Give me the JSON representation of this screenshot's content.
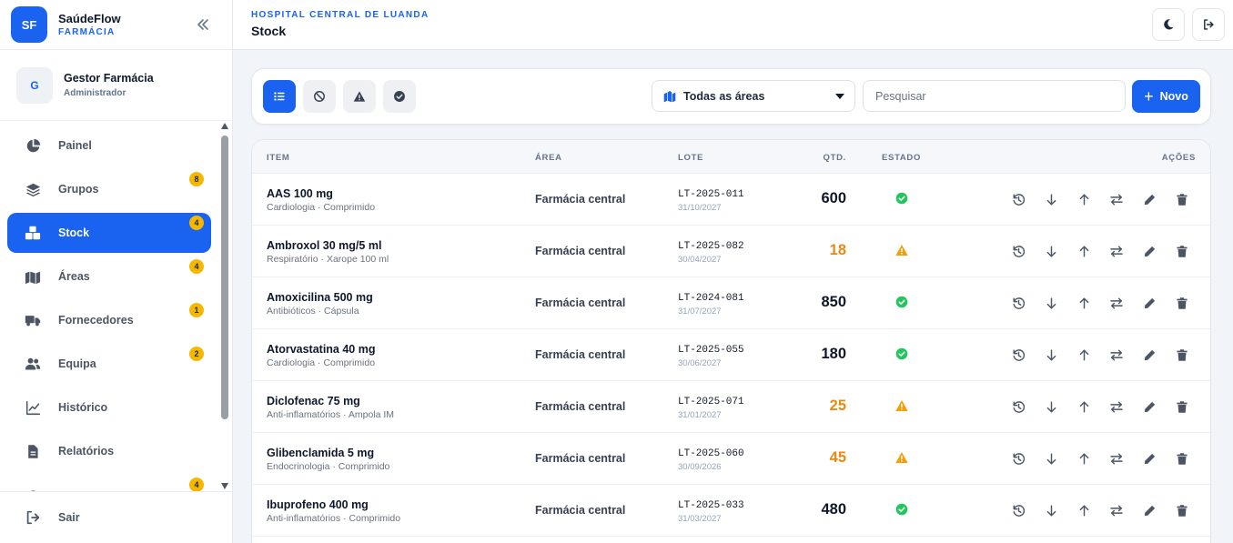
{
  "brand": {
    "logo": "SF",
    "name": "SaúdeFlow",
    "subtitle": "FARMÁCIA"
  },
  "user": {
    "initial": "G",
    "name": "Gestor Farmácia",
    "role": "Administrador"
  },
  "sidebar": {
    "items": [
      {
        "label": "Painel",
        "icon": "pie-chart-icon",
        "badge": ""
      },
      {
        "label": "Grupos",
        "icon": "layers-icon",
        "badge": "8"
      },
      {
        "label": "Stock",
        "icon": "boxes-icon",
        "badge": "4",
        "active": true
      },
      {
        "label": "Áreas",
        "icon": "map-icon",
        "badge": "4"
      },
      {
        "label": "Fornecedores",
        "icon": "truck-icon",
        "badge": "1"
      },
      {
        "label": "Equipa",
        "icon": "users-icon",
        "badge": "2"
      },
      {
        "label": "Histórico",
        "icon": "chart-line-icon",
        "badge": ""
      },
      {
        "label": "Relatórios",
        "icon": "file-icon",
        "badge": ""
      },
      {
        "label": "",
        "icon": "settings-icon",
        "badge": "4"
      }
    ],
    "logout_label": "Sair"
  },
  "header": {
    "hospital": "HOSPITAL CENTRAL DE LUANDA",
    "title": "Stock"
  },
  "toolbar": {
    "filters": [
      "list-icon",
      "ban-icon",
      "warning-icon",
      "check-circle-icon"
    ],
    "area_select": "Todas as áreas",
    "search_placeholder": "Pesquisar",
    "new_label": "Novo"
  },
  "table": {
    "columns": {
      "item": "ITEM",
      "area": "ÁREA",
      "lote": "LOTE",
      "qtd": "QTD.",
      "estado": "ESTADO",
      "acoes": "AÇÕES"
    },
    "rows": [
      {
        "name": "AAS 100 mg",
        "sub": "Cardiologia · Comprimido",
        "area": "Farmácia central",
        "lote": "LT-2025-011",
        "date": "31/10/2027",
        "qty": "600",
        "status": "ok"
      },
      {
        "name": "Ambroxol 30 mg/5 ml",
        "sub": "Respiratório · Xarope 100 ml",
        "area": "Farmácia central",
        "lote": "LT-2025-082",
        "date": "30/04/2027",
        "qty": "18",
        "status": "low"
      },
      {
        "name": "Amoxicilina 500 mg",
        "sub": "Antibióticos · Cápsula",
        "area": "Farmácia central",
        "lote": "LT-2024-081",
        "date": "31/07/2027",
        "qty": "850",
        "status": "ok"
      },
      {
        "name": "Atorvastatina 40 mg",
        "sub": "Cardiologia · Comprimido",
        "area": "Farmácia central",
        "lote": "LT-2025-055",
        "date": "30/06/2027",
        "qty": "180",
        "status": "ok"
      },
      {
        "name": "Diclofenac 75 mg",
        "sub": "Anti-inflamatórios · Ampola IM",
        "area": "Farmácia central",
        "lote": "LT-2025-071",
        "date": "31/01/2027",
        "qty": "25",
        "status": "low"
      },
      {
        "name": "Glibenclamida 5 mg",
        "sub": "Endocrinologia · Comprimido",
        "area": "Farmácia central",
        "lote": "LT-2025-060",
        "date": "30/09/2026",
        "qty": "45",
        "status": "low"
      },
      {
        "name": "Ibuprofeno 400 mg",
        "sub": "Anti-inflamatórios · Comprimido",
        "area": "Farmácia central",
        "lote": "LT-2025-033",
        "date": "31/03/2027",
        "qty": "480",
        "status": "ok"
      }
    ],
    "actions": [
      "history-icon",
      "arrow-down-icon",
      "arrow-up-icon",
      "transfer-icon",
      "edit-icon",
      "trash-icon"
    ]
  },
  "colors": {
    "accent": "#1a62f0",
    "ok": "#22c55e",
    "low": "#e98a12",
    "badge": "#f5b800"
  }
}
